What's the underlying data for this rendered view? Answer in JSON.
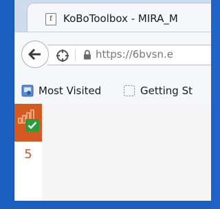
{
  "browser": {
    "tab": {
      "title": "KoBoToolbox - MIRA_M",
      "favicon_letter": "f"
    },
    "address_bar": {
      "url": "https://6bvsn.e"
    },
    "bookmarks": [
      {
        "label": "Most Visited",
        "icon": "most-visited-icon"
      },
      {
        "label": "Getting St",
        "icon": "getting-started-icon"
      }
    ]
  },
  "app": {
    "brand_color": "#d45a1f",
    "badge_color": "#2a9c3c",
    "sidebar": {
      "count": "5"
    }
  }
}
